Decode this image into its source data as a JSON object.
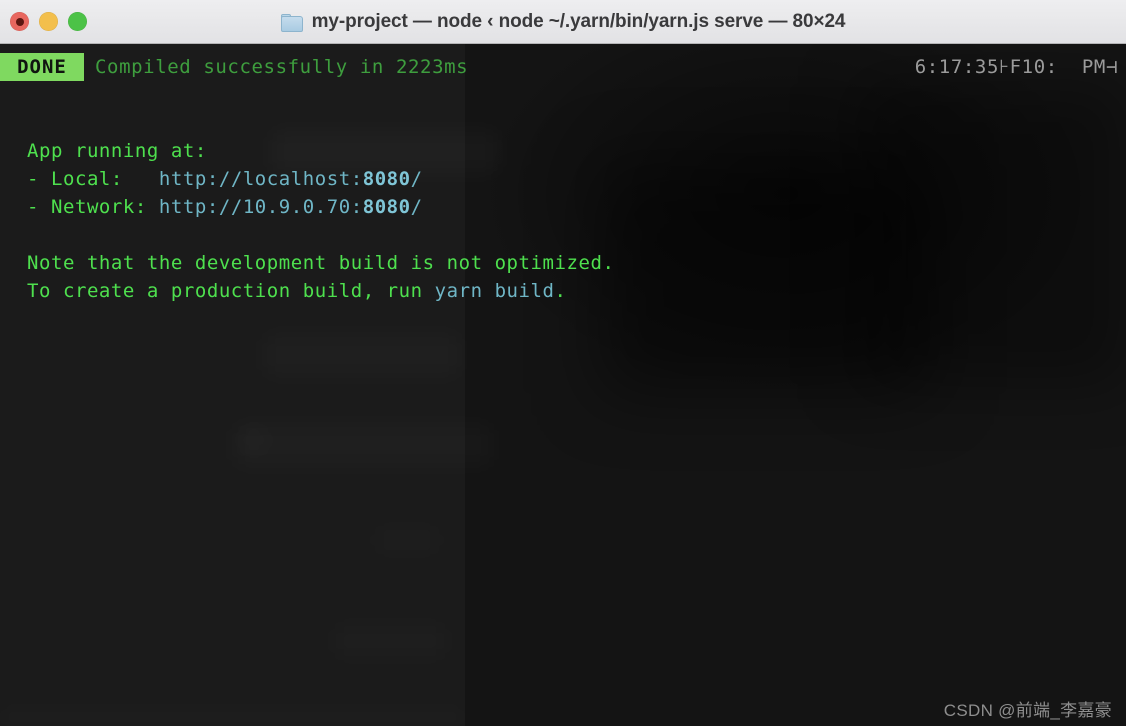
{
  "window": {
    "title": "my-project — node ‹ node ~/.yarn/bin/yarn.js serve — 80×24",
    "controls": {
      "close_label": "close",
      "minimize_label": "minimize",
      "zoom_label": "zoom"
    },
    "folder_icon": "folder-icon"
  },
  "statusline": {
    "badge": "DONE",
    "message": "Compiled successfully in 2223ms",
    "clock": "6:17:35",
    "fkey": "⊦F10:  PM⊣"
  },
  "terminal": {
    "lines": [
      {
        "text": "App running at:",
        "segments": [
          {
            "t": "App running at:",
            "c": "g"
          }
        ]
      },
      {
        "text": "- Local:   http://localhost:8080/",
        "segments": [
          {
            "t": "- Local:   ",
            "c": "g"
          },
          {
            "t": "http://localhost:",
            "c": "c"
          },
          {
            "t": "8080",
            "c": "cb"
          },
          {
            "t": "/",
            "c": "c"
          }
        ]
      },
      {
        "text": "- Network: http://10.9.0.70:8080/",
        "segments": [
          {
            "t": "- Network: ",
            "c": "g"
          },
          {
            "t": "http://10.9.0.70:",
            "c": "c"
          },
          {
            "t": "8080",
            "c": "cb"
          },
          {
            "t": "/",
            "c": "c"
          }
        ]
      },
      {
        "text": "",
        "segments": []
      },
      {
        "text": "Note that the development build is not optimized.",
        "segments": [
          {
            "t": "Note that the development build is not optimized.",
            "c": "g"
          }
        ]
      },
      {
        "text": "To create a production build, run yarn build.",
        "segments": [
          {
            "t": "To create a production build, run ",
            "c": "g"
          },
          {
            "t": "yarn build",
            "c": "c"
          },
          {
            "t": ".",
            "c": "g"
          }
        ]
      }
    ]
  },
  "watermark": {
    "text": "CSDN @前端_李嘉豪"
  },
  "colors": {
    "titlebar_bg": "#e8e8ea",
    "terminal_bg": "#181818",
    "badge_bg": "#7fd960",
    "green": "#4ee04e",
    "status_green": "#3e9e3e",
    "cyan": "#6fb6c6",
    "cyan_bold": "#7fc5d6",
    "close": "#e8675f",
    "minimize": "#f3bf4c",
    "zoom": "#4cc247"
  }
}
